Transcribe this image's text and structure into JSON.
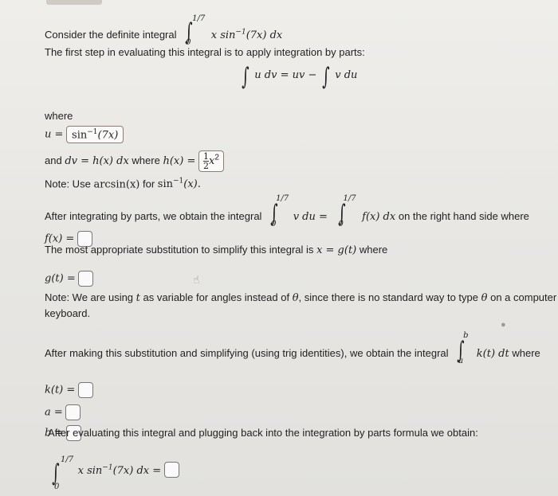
{
  "intro": {
    "consider": "Consider the definite integral",
    "integrand": "x sin",
    "integrand_rest": "(7x) dx",
    "upper": "1/7",
    "lower": "0"
  },
  "first_step": "The first step in evaluating this integral is to apply integration by parts:",
  "parts_formula": {
    "left": "u dv = uv −",
    "right": "v du"
  },
  "where_label": "where",
  "u_def": {
    "label": "u =",
    "value": "sin"
  },
  "dv_def": {
    "text_and": "and",
    "expr": "dv = h(x) dx",
    "text_where": "where",
    "h_label": "h(x) =",
    "h_num": "1",
    "h_den": "2",
    "h_var": "x"
  },
  "note_arcsin": {
    "prefix": "Note: Use",
    "arcsin": "arcsin(x)",
    "middle": "for",
    "sin_inv": "sin",
    "suffix": "(x)."
  },
  "after_parts": {
    "prefix": "After integrating by parts, we obtain the integral",
    "vdu": "v du =",
    "fx": "f(x) dx",
    "suffix": "on the right hand side where"
  },
  "f_label": "f(x) =",
  "substitution_text": "The most appropriate substitution to simplify this integral is",
  "substitution_expr": "x = g(t)",
  "substitution_where": "where",
  "g_label": "g(t) =",
  "note_theta": {
    "prefix": "Note: We are using",
    "t": "t",
    "middle": "as variable for angles instead of",
    "theta": "θ",
    "middle2": ", since there is no standard way to type",
    "theta2": "θ",
    "suffix": "on a computer",
    "line2": "keyboard."
  },
  "after_sub": {
    "text": "After making this substitution and simplifying (using trig identities), we obtain the integral",
    "kt": "k(t) dt",
    "where": "where",
    "upper": "b",
    "lower": "a"
  },
  "k_label": "k(t) =",
  "a_label": "a =",
  "b_label": "b =",
  "final_text": "After evaluating this integral and plugging back into the integration by parts formula we obtain:",
  "final_expr": {
    "integrand": "x sin",
    "rest": "(7x) dx =",
    "upper": "1/7",
    "lower": "0"
  },
  "common": {
    "inv": "−1",
    "arg7x": "(7x)",
    "sq": "2",
    "upper_17": "1/7",
    "lower_0": "0"
  }
}
